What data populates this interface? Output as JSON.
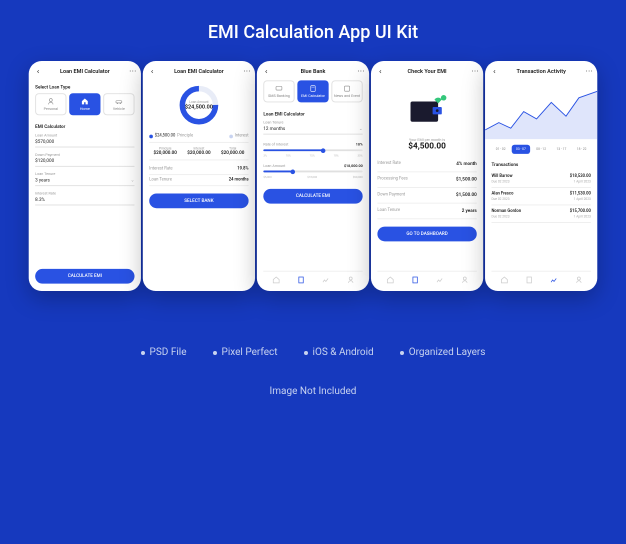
{
  "mainTitle": "EMI Calculation App UI Kit",
  "features": [
    "PSD File",
    "Pixel Perfect",
    "iOS & Android",
    "Organized Layers"
  ],
  "footerNote": "Image Not Included",
  "colors": {
    "primary": "#2952E3",
    "bg": "#1639BE"
  },
  "screen1": {
    "title": "Loan EMI Calculator",
    "selectLabel": "Select Loan Type",
    "tabs": [
      "Personal",
      "Home",
      "Vehicle"
    ],
    "sectionLabel": "EMI Calculator",
    "fields": {
      "loanAmount": {
        "label": "Loan Amount",
        "value": "$570,000"
      },
      "downPayment": {
        "label": "Down Payment",
        "value": "$120,000"
      },
      "loanTenure": {
        "label": "Loan Tenure",
        "value": "3 years"
      },
      "interestRate": {
        "label": "Interest Rate",
        "value": "8.3%"
      }
    },
    "button": "CALCULATE EMI"
  },
  "screen2": {
    "title": "Loan EMI Calculator",
    "donut": {
      "label": "Loan Amount",
      "value": "$24,500.00"
    },
    "legend": {
      "left": {
        "label": "Principle",
        "value": "$24,500.00"
      },
      "right": {
        "label": "Interest"
      }
    },
    "stats": [
      {
        "label": "Principle",
        "value": "$20,000.00"
      },
      {
        "label": "Interest",
        "value": "$20,000.00"
      },
      {
        "label": "Total",
        "value": "$20,000.00"
      }
    ],
    "rows": {
      "interestRate": {
        "label": "Interest Rate",
        "value": "19.8%"
      },
      "loanTenure": {
        "label": "Loan Tenure",
        "value": "24 months"
      }
    },
    "button": "SELECT BANK"
  },
  "screen3": {
    "title": "Blue Bank",
    "tabs": [
      "SMS Banking",
      "EMI Calculator",
      "News and Event"
    ],
    "sectionLabel": "Loan EMI Calculator",
    "tenure": {
      "label": "Loan Tenure",
      "value": "12 months"
    },
    "sliders": {
      "interest": {
        "label": "Rate of Interest",
        "value": "18%",
        "ticks": [
          "3%",
          "10%",
          "15%",
          "18%",
          "30%"
        ],
        "pos": 60
      },
      "amount": {
        "label": "Loan Amount",
        "value": "$18,000.00",
        "ticks": [
          "$5,000",
          "$18,000",
          "$90,000"
        ],
        "pos": 30
      }
    },
    "button": "CALCULATE EMI"
  },
  "screen4": {
    "title": "Check Your EMI",
    "result": {
      "label": "Your EMI per month is",
      "value": "$4,500.00"
    },
    "details": [
      {
        "label": "Interest Rate",
        "value": "4% month"
      },
      {
        "label": "Processing Fees",
        "value": "$1,500.00"
      },
      {
        "label": "Down Payment",
        "value": "$1,500.00"
      },
      {
        "label": "Loan Tenure",
        "value": "2 years"
      }
    ],
    "button": "GO TO DASHBOARD"
  },
  "screen5": {
    "title": "Transaction Activity",
    "dateTabs": [
      "01 - 02",
      "03 - 07",
      "08 - 12",
      "13 - 17",
      "18 - 22"
    ],
    "sectionLabel": "Transactions",
    "transactions": [
      {
        "name": "Will Barrow",
        "amount": "$18,530.00",
        "date": "Due 02 2023",
        "sub": "1 April 2023"
      },
      {
        "name": "Alan Fresco",
        "amount": "$11,530.00",
        "date": "Due 02 2023",
        "sub": "1 April 2023"
      },
      {
        "name": "Norman Gordon",
        "amount": "$15,700.00",
        "date": "Due 02 2023",
        "sub": "1 April 2023"
      }
    ]
  }
}
